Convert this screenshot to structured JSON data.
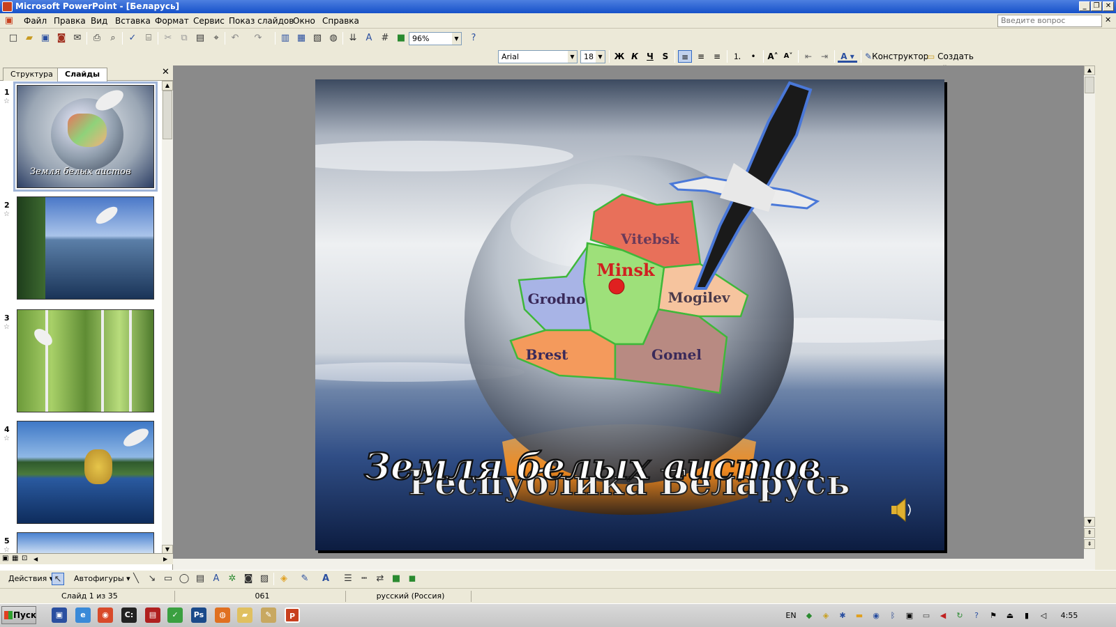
{
  "window": {
    "title": "Microsoft PowerPoint - [Беларусь]"
  },
  "menu": {
    "items": [
      "Файл",
      "Правка",
      "Вид",
      "Вставка",
      "Формат",
      "Сервис",
      "Показ слайдов",
      "Окно",
      "Справка"
    ],
    "help_placeholder": "Введите вопрос"
  },
  "toolbar": {
    "zoom": "96%",
    "font_name": "Arial",
    "font_size": "18",
    "bold": "Ж",
    "italic": "К",
    "underline": "Ч",
    "shadow": "S",
    "designer_label": "Конструктор",
    "new_slide_label": "Создать слайд"
  },
  "left_pane": {
    "tab_outline": "Структура",
    "tab_slides": "Слайды",
    "close": "✕",
    "thumbnails": [
      {
        "number": "1",
        "caption": "Земля белых аистов",
        "selected": true
      },
      {
        "number": "2"
      },
      {
        "number": "3"
      },
      {
        "number": "4"
      },
      {
        "number": "5"
      }
    ]
  },
  "slide": {
    "title_front": "Земля белых аистов",
    "title_back": "Республика Беларусь",
    "regions": [
      "Vitebsk",
      "Minsk",
      "Grodno",
      "Mogilev",
      "Brest",
      "Gomel"
    ],
    "sound_icon": "speaker-icon"
  },
  "drawing_toolbar": {
    "actions": "Действия",
    "autoshapes": "Автофигуры"
  },
  "status": {
    "slide_counter": "Слайд 1 из 35",
    "design": "061",
    "language": "русский (Россия)"
  },
  "taskbar": {
    "start": "Пуск",
    "lang": "EN",
    "clock": "4:55"
  }
}
